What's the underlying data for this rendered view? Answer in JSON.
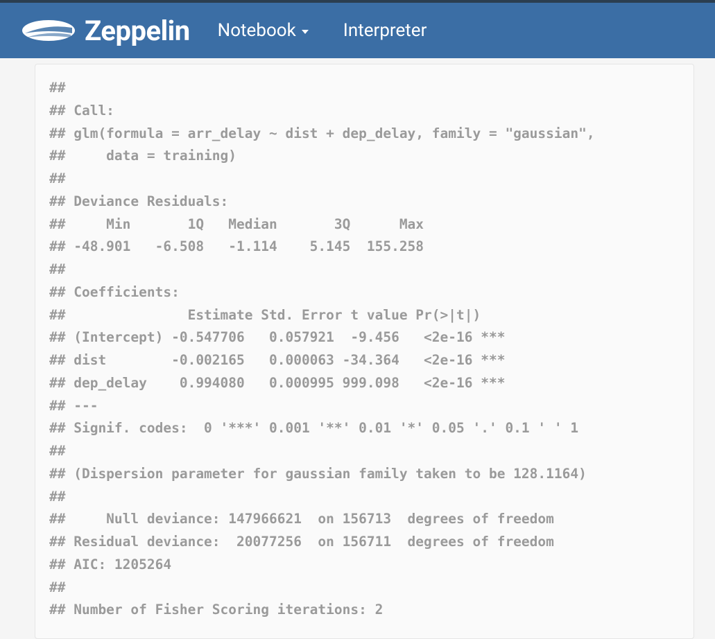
{
  "header": {
    "brand": "Zeppelin",
    "nav": {
      "notebook": "Notebook",
      "interpreter": "Interpreter"
    }
  },
  "output": {
    "lines": "## \n## Call:\n## glm(formula = arr_delay ~ dist + dep_delay, family = \"gaussian\", \n##     data = training)\n## \n## Deviance Residuals: \n##     Min       1Q   Median       3Q      Max  \n## -48.901   -6.508   -1.114    5.145  155.258  \n## \n## Coefficients:\n##               Estimate Std. Error t value Pr(>|t|)    \n## (Intercept) -0.547706   0.057921  -9.456   <2e-16 ***\n## dist        -0.002165   0.000063 -34.364   <2e-16 ***\n## dep_delay    0.994080   0.000995 999.098   <2e-16 ***\n## ---\n## Signif. codes:  0 '***' 0.001 '**' 0.01 '*' 0.05 '.' 0.1 ' ' 1\n## \n## (Dispersion parameter for gaussian family taken to be 128.1164)\n## \n##     Null deviance: 147966621  on 156713  degrees of freedom\n## Residual deviance:  20077256  on 156711  degrees of freedom\n## AIC: 1205264\n## \n## Number of Fisher Scoring iterations: 2"
  }
}
